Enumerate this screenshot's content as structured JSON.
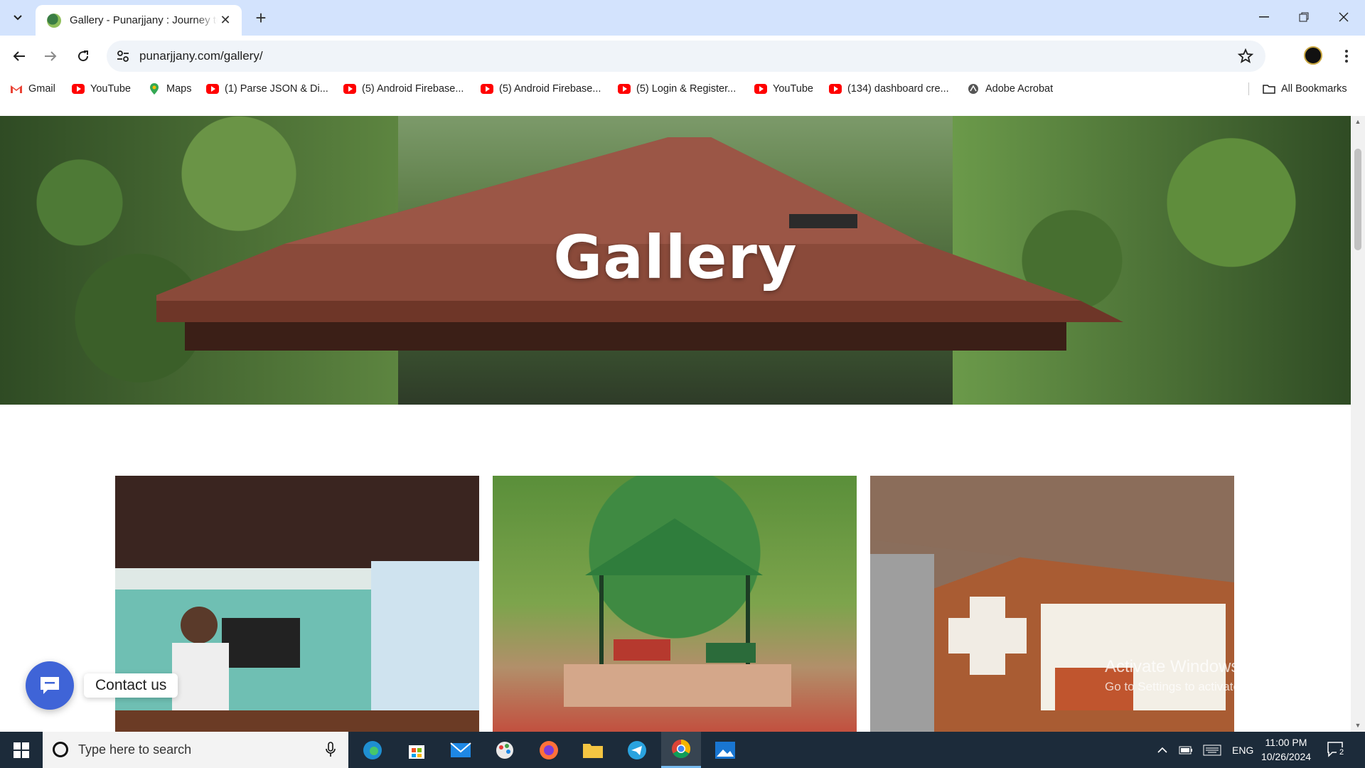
{
  "browser": {
    "tab_title": "Gallery - Punarjjany : Journey to",
    "url": "punarjjany.com/gallery/"
  },
  "bookmarks": [
    {
      "label": "Gmail",
      "icon": "gmail-icon"
    },
    {
      "label": "YouTube",
      "icon": "youtube-icon"
    },
    {
      "label": "Maps",
      "icon": "maps-icon"
    },
    {
      "label": "(1) Parse JSON & Di...",
      "icon": "youtube-icon"
    },
    {
      "label": "(5) Android Firebase...",
      "icon": "youtube-icon"
    },
    {
      "label": "(5) Android Firebase...",
      "icon": "youtube-icon"
    },
    {
      "label": "(5) Login & Register...",
      "icon": "youtube-icon"
    },
    {
      "label": "YouTube",
      "icon": "youtube-icon"
    },
    {
      "label": "(134) dashboard cre...",
      "icon": "youtube-icon"
    },
    {
      "label": "Adobe Acrobat",
      "icon": "acrobat-icon"
    }
  ],
  "all_bookmarks_label": "All Bookmarks",
  "page": {
    "hero_title": "Gallery",
    "contact_label": "Contact us"
  },
  "watermark": {
    "line1": "Activate Windows",
    "line2": "Go to Settings to activate Windows."
  },
  "taskbar": {
    "search_placeholder": "Type here to search",
    "language": "ENG",
    "time": "11:00 PM",
    "date": "10/26/2024",
    "notification_count": "2"
  },
  "colors": {
    "tab_strip": "#d3e3fd",
    "taskbar": "#1c2b3a",
    "contact_button": "#3f64d7"
  }
}
